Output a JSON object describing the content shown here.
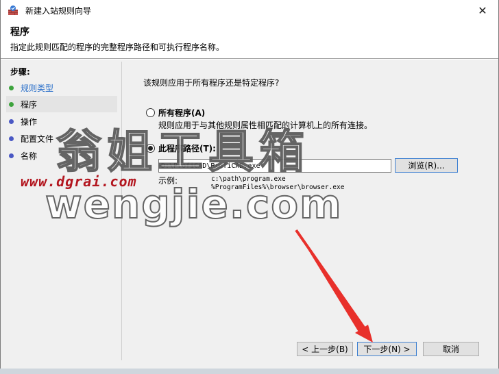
{
  "window": {
    "title": "新建入站规则向导",
    "close_glyph": "✕"
  },
  "header": {
    "title": "程序",
    "description": "指定此规则匹配的程序的完整程序路径和可执行程序名称。"
  },
  "steps": {
    "heading": "步骤:",
    "items": [
      {
        "label": "规则类型",
        "state": "done"
      },
      {
        "label": "程序",
        "state": "current"
      },
      {
        "label": "操作",
        "state": "todo"
      },
      {
        "label": "配置文件",
        "state": "todo"
      },
      {
        "label": "名称",
        "state": "todo"
      }
    ]
  },
  "content": {
    "question": "该规则应用于所有程序还是特定程序?",
    "all_programs": {
      "label": "所有程序(A)",
      "description": "规则应用于与其他规则属性相匹配的计算机上的所有连接。",
      "selected": false
    },
    "this_program": {
      "label": "此程序路径(T):",
      "selected": true,
      "path_value": "D:\\ProfiCAD\\ProfiCAD.exe",
      "browse_label": "浏览(R)..."
    },
    "example_label": "示例:",
    "example_lines": [
      "c:\\path\\program.exe",
      "%ProgramFiles%\\browser\\browser.exe"
    ]
  },
  "buttons": {
    "back": "< 上一步(B)",
    "next": "下一步(N) >",
    "cancel": "取消"
  },
  "watermark": {
    "cn": "翁姐工具箱",
    "url_small": "www.dgrai.com",
    "url_large": "wengjie.com"
  },
  "colors": {
    "done_dot": "#3da33d",
    "todo_dot": "#4a58c4",
    "link_text": "#2a6fc9",
    "focus_border": "#3c7fd1",
    "arrow": "#e8302b"
  },
  "icons": {
    "app": "firewall-icon",
    "close": "close-icon"
  }
}
